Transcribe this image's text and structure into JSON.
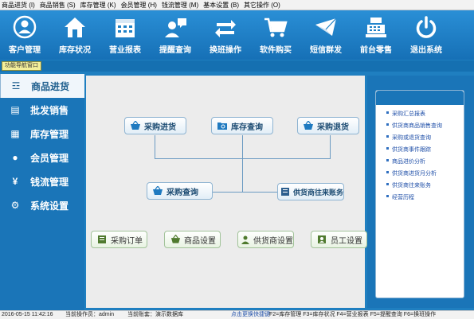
{
  "menubar": [
    "商品进货 (I)",
    "商品销售 (S)",
    "库存管理 (K)",
    "会员管理 (H)",
    "钱流管理 (M)",
    "基本设置 (B)",
    "其它操作 (O)"
  ],
  "toolbar": [
    {
      "label": "客户管理",
      "icon": "user-circle-icon"
    },
    {
      "label": "库存状况",
      "icon": "house-icon"
    },
    {
      "label": "营业报表",
      "icon": "calendar-icon"
    },
    {
      "label": "提醒查询",
      "icon": "chat-user-icon"
    },
    {
      "label": "换班操作",
      "icon": "swap-arrows-icon"
    },
    {
      "label": "软件购买",
      "icon": "cart-icon"
    },
    {
      "label": "短信群发",
      "icon": "envelope-icon"
    },
    {
      "label": "前台零售",
      "icon": "cash-register-icon"
    },
    {
      "label": "退出系统",
      "icon": "power-icon"
    }
  ],
  "nav_window_title": "功能导航窗口",
  "sidebar": [
    {
      "label": "商品进货",
      "icon": "basket-icon",
      "active": true
    },
    {
      "label": "批发销售",
      "icon": "ledger-icon"
    },
    {
      "label": "库存管理",
      "icon": "grid-icon"
    },
    {
      "label": "会员管理",
      "icon": "person-icon"
    },
    {
      "label": "钱流管理",
      "icon": "yen-icon"
    },
    {
      "label": "系统设置",
      "icon": "gear-icon"
    }
  ],
  "flow": {
    "purchase_in": "采购进货",
    "stock_query": "库存查询",
    "purchase_return": "采购退货",
    "purchase_query": "采购查询",
    "supplier_account": "供货商往来账务",
    "purchase_order": "采购订单",
    "goods_setting": "商品设置",
    "supplier_setting": "供货商设置",
    "staff_setting": "员工设置"
  },
  "reports": [
    "采购汇总报表",
    "供货商商品销售查询",
    "采购或退货查询",
    "供货商事件跟踪",
    "商品进价分析",
    "供货商进货月分析",
    "供货商往来账务",
    "经营历程"
  ],
  "status": {
    "datetime": "2016-05-15 11:42:16",
    "operator": "当前操作员：admin",
    "account": "当前账套：演示数据库",
    "shortcut_link": "点击更换快捷键",
    "shortcuts": "F2=库存管理  F3=库存状况  F4=营业报表  F5=提醒查询  F6=换班操作"
  }
}
